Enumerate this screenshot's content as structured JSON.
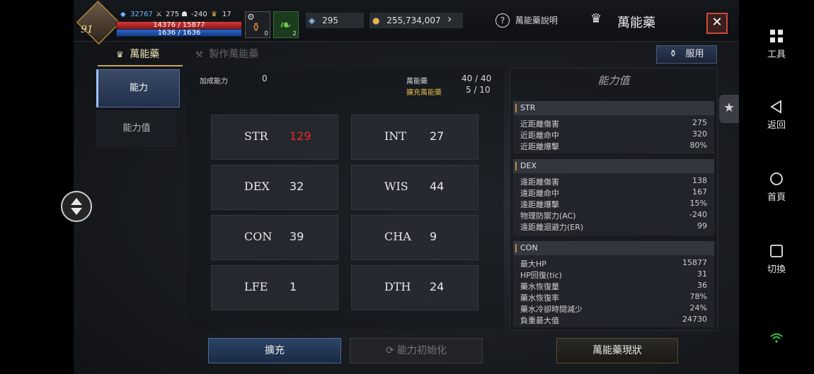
{
  "hud": {
    "level": "91",
    "exp_value": "32767",
    "stat_a": "275",
    "stat_b": "-240",
    "stat_c": "17",
    "hp": "14376 / 15877",
    "mp": "1636 / 1636",
    "slot1_count": "0",
    "slot2_count": "2",
    "currency_a": "295",
    "currency_gold": "255,734,007",
    "help_label": "萬能藥說明",
    "window_title": "萬能藥",
    "close_symbol": "✕"
  },
  "tabs": [
    {
      "label": "萬能藥",
      "active": true
    },
    {
      "label": "製作萬能藥",
      "active": false
    }
  ],
  "use_button": "服用",
  "side_nav": [
    {
      "label": "能力",
      "active": true
    },
    {
      "label": "能力值",
      "active": false
    }
  ],
  "info": {
    "bonus_label": "加成能力",
    "bonus_value": "0",
    "elixir_label": "萬能藥",
    "elixir_value": "40 / 40",
    "expand_label": "擴充萬能藥",
    "expand_value": "5 / 10"
  },
  "stats": [
    {
      "name": "STR",
      "value": "129",
      "highlight": true
    },
    {
      "name": "INT",
      "value": "27",
      "highlight": false
    },
    {
      "name": "DEX",
      "value": "32",
      "highlight": false
    },
    {
      "name": "WIS",
      "value": "44",
      "highlight": false
    },
    {
      "name": "CON",
      "value": "39",
      "highlight": false
    },
    {
      "name": "CHA",
      "value": "9",
      "highlight": false
    },
    {
      "name": "LFE",
      "value": "1",
      "highlight": false
    },
    {
      "name": "DTH",
      "value": "24",
      "highlight": false
    }
  ],
  "right_panel": {
    "title": "能力值",
    "groups": [
      {
        "header": "STR",
        "rows": [
          {
            "label": "近距離傷害",
            "value": "275"
          },
          {
            "label": "近距離命中",
            "value": "320"
          },
          {
            "label": "近距離爆擊",
            "value": "80%"
          }
        ]
      },
      {
        "header": "DEX",
        "rows": [
          {
            "label": "遠距離傷害",
            "value": "138"
          },
          {
            "label": "遠距離命中",
            "value": "167"
          },
          {
            "label": "遠距離爆擊",
            "value": "15%"
          },
          {
            "label": "物理防禦力(AC)",
            "value": "-240"
          },
          {
            "label": "遠距離迴避力(ER)",
            "value": "99"
          }
        ]
      },
      {
        "header": "CON",
        "rows": [
          {
            "label": "最大HP",
            "value": "15877"
          },
          {
            "label": "HP回復(tic)",
            "value": "31"
          },
          {
            "label": "藥水恢復量",
            "value": "36"
          },
          {
            "label": "藥水恢復率",
            "value": "78%"
          },
          {
            "label": "藥水冷卻時間減少",
            "value": "24%"
          },
          {
            "label": "負重最大值",
            "value": "24730"
          }
        ]
      }
    ]
  },
  "bottom": {
    "expand": "擴充",
    "reset": "能力初始化",
    "status": "萬能藥現狀"
  },
  "system": {
    "tools": "工具",
    "back": "返回",
    "home": "首頁",
    "switch": "切換"
  },
  "colors": {
    "highlight_red": "#e52a2a",
    "accent_blue": "#9fc1ff",
    "hp_red": "#d43a3a",
    "mp_blue": "#2b68c9",
    "gold": "#e0b84a"
  }
}
